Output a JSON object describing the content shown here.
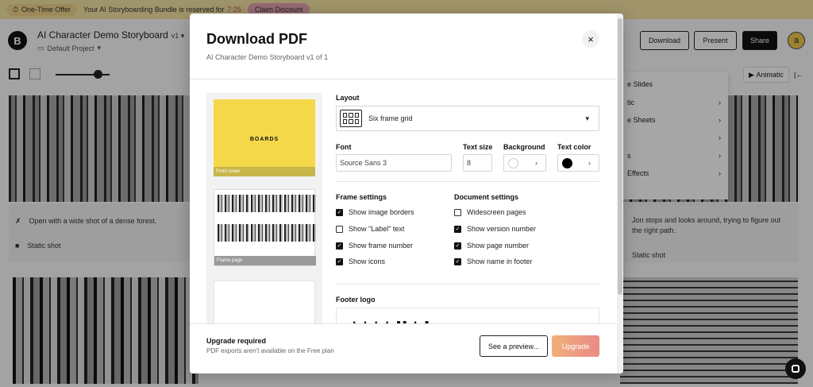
{
  "promo": {
    "badge": "One-Time Offer",
    "message": "Your AI Storyboarding Bundle is reserved for",
    "timer": "7:25",
    "cta": "Claim Discount"
  },
  "project": {
    "logo_letter": "B",
    "title": "AI Character Demo Storyboard",
    "version": "v1",
    "folder": "Default Project"
  },
  "topbar": {
    "download": "Download",
    "present": "Present",
    "share": "Share",
    "avatar_letter": "a"
  },
  "toolbar": {
    "animatic": "Animatic"
  },
  "dropdown": {
    "items": [
      {
        "label": "e Slides",
        "arrow": ""
      },
      {
        "label": "tic",
        "arrow": "›"
      },
      {
        "label": "e Sheets",
        "arrow": "›"
      },
      {
        "label": "",
        "arrow": "›"
      },
      {
        "label": "s",
        "arrow": "›"
      },
      {
        "label": "Effects",
        "arrow": "›"
      }
    ]
  },
  "frames": {
    "left_action": "Open with a wide shot of a dense forest.",
    "left_shot": "Static shot",
    "right_action": "Jon stops and looks around, trying to figure out the right path.",
    "right_shot": "Static shot"
  },
  "modal": {
    "title": "Download PDF",
    "subtitle": "AI Character Demo Storyboard v1 of 1",
    "close": "×",
    "preview": {
      "brand": "BOARDS",
      "cover_label": "Front cover",
      "frames_label": "Frame page"
    },
    "layout_label": "Layout",
    "layout_value": "Six frame grid",
    "font_label": "Font",
    "font_value": "Source Sans 3",
    "text_size_label": "Text size",
    "text_size_value": "8",
    "background_label": "Background",
    "background_color": "#ffffff",
    "text_color_label": "Text color",
    "text_color": "#000000",
    "frame_settings_label": "Frame settings",
    "frame_settings": [
      {
        "label": "Show image borders",
        "checked": true
      },
      {
        "label": "Show \"Label\" text",
        "checked": false
      },
      {
        "label": "Show frame number",
        "checked": true
      },
      {
        "label": "Show icons",
        "checked": true
      }
    ],
    "document_settings_label": "Document settings",
    "document_settings": [
      {
        "label": "Widescreen pages",
        "checked": false
      },
      {
        "label": "Show version number",
        "checked": true
      },
      {
        "label": "Show page number",
        "checked": true
      },
      {
        "label": "Show name in footer",
        "checked": true
      }
    ],
    "footer_logo_label": "Footer logo",
    "upgrade_title": "Upgrade required",
    "upgrade_sub": "PDF exports aren't available on the Free plan",
    "preview_button": "See a preview...",
    "upgrade_button": "Upgrade"
  }
}
